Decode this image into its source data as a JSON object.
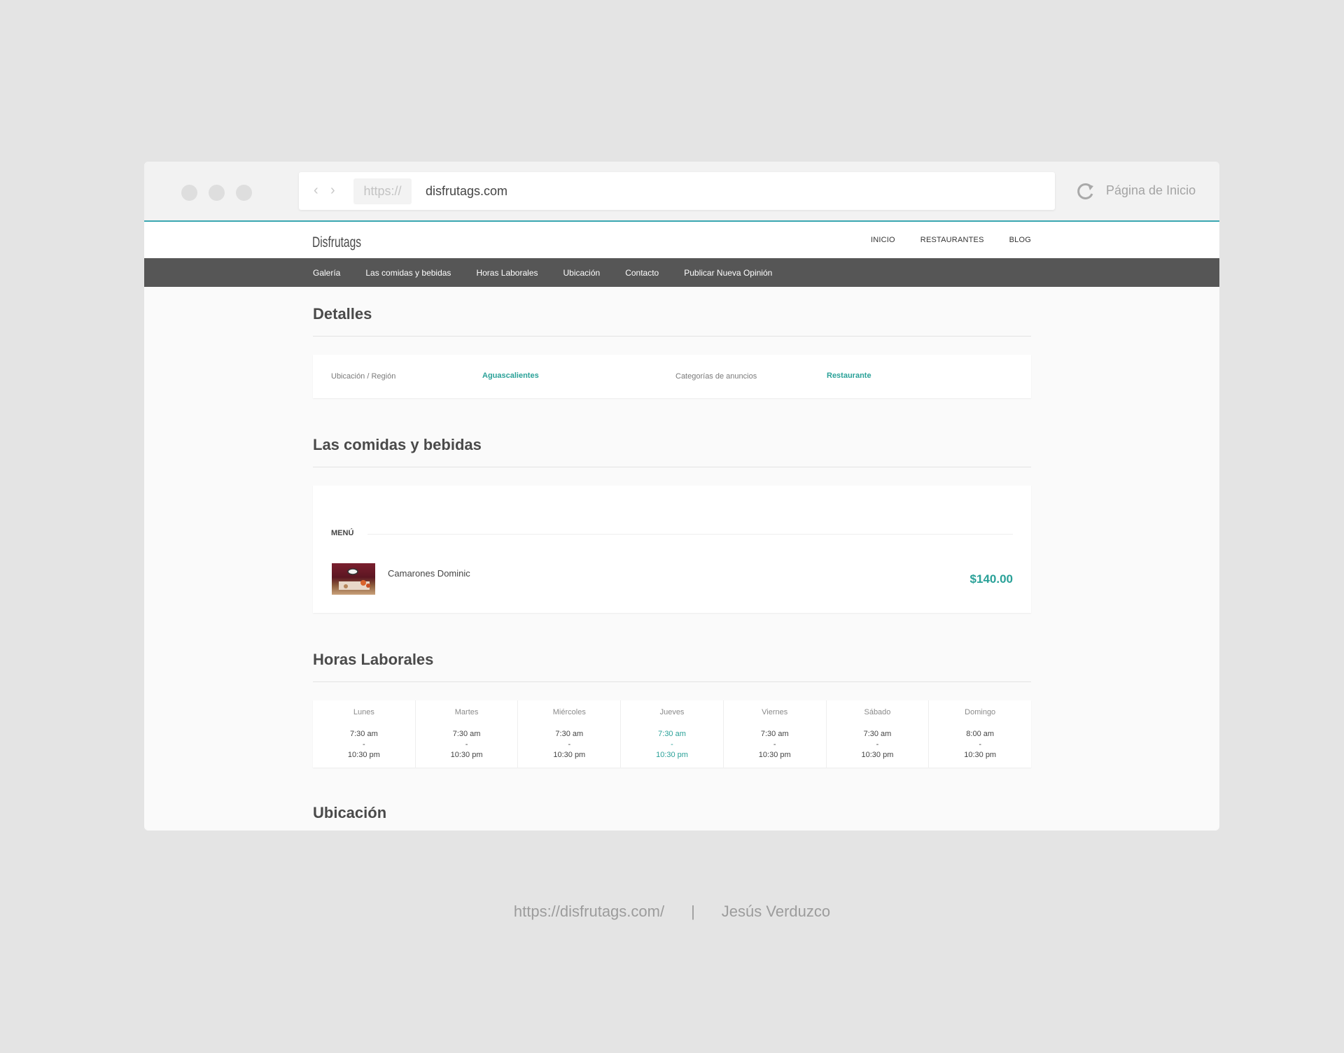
{
  "browser": {
    "protocol": "https://",
    "domain": "disfrutags.com",
    "home_link": "Página de Inicio"
  },
  "site": {
    "logo_text": "Disfrutags",
    "top_nav": [
      "INICIO",
      "RESTAURANTES",
      "BLOG"
    ],
    "sub_nav": [
      "Galería",
      "Las comidas y bebidas",
      "Horas Laborales",
      "Ubicación",
      "Contacto",
      "Publicar Nueva Opinión"
    ]
  },
  "details": {
    "title": "Detalles",
    "location_label": "Ubicación / Región",
    "location_value": "Aguascalientes",
    "category_label": "Categorías de anuncios",
    "category_value": "Restaurante"
  },
  "food": {
    "title": "Las comidas y bebidas",
    "menu_heading": "MENÚ",
    "item_name": "Camarones Dominic",
    "item_price": "$140.00"
  },
  "hours": {
    "title": "Horas Laborales",
    "days": [
      {
        "name": "Lunes",
        "open": "7:30 am",
        "sep": "-",
        "close": "10:30 pm"
      },
      {
        "name": "Martes",
        "open": "7:30 am",
        "sep": "-",
        "close": "10:30 pm"
      },
      {
        "name": "Miércoles",
        "open": "7:30 am",
        "sep": "-",
        "close": "10:30 pm"
      },
      {
        "name": "Jueves",
        "open": "7:30 am",
        "sep": "-",
        "close": "10:30 pm"
      },
      {
        "name": "Viernes",
        "open": "7:30 am",
        "sep": "-",
        "close": "10:30 pm"
      },
      {
        "name": "Sábado",
        "open": "7:30 am",
        "sep": "-",
        "close": "10:30 pm"
      },
      {
        "name": "Domingo",
        "open": "8:00 am",
        "sep": "-",
        "close": "10:30 pm"
      }
    ]
  },
  "location_section": {
    "title": "Ubicación"
  },
  "caption": {
    "url": "https://disfrutags.com/",
    "separator": "|",
    "author": "Jesús Verduzco"
  },
  "colors": {
    "accent": "#2aa198",
    "subnav_bg": "#565656",
    "page_bg": "#e4e4e4"
  }
}
